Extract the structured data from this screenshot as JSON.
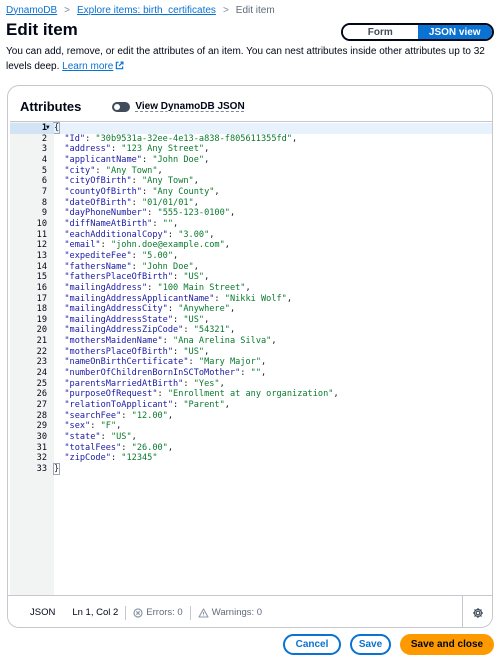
{
  "breadcrumb": {
    "items": [
      "DynamoDB",
      "Explore items: birth_certificates"
    ],
    "current": "Edit item",
    "separator": ">"
  },
  "header": {
    "title": "Edit item",
    "view_toggle": {
      "form_label": "Form",
      "json_label": "JSON view",
      "selected": "JSON view"
    }
  },
  "description": {
    "text": "You can add, remove, or edit the attributes of an item. You can nest attributes inside other attributes up to 32 levels deep.",
    "learn_more": "Learn more"
  },
  "attributes": {
    "title": "Attributes",
    "toggle_label": "View DynamoDB JSON",
    "toggle_on": false
  },
  "editor": {
    "active_line": 1,
    "lines": [
      {
        "n": "1",
        "type": "open",
        "text": "{"
      },
      {
        "n": "2",
        "key": "\"Id\"",
        "value": "\"30b9531a-32ee-4e13-a838-f805611355fd\"",
        "comma": ","
      },
      {
        "n": "3",
        "key": "\"address\"",
        "value": "\"123 Any Street\"",
        "comma": ","
      },
      {
        "n": "4",
        "key": "\"applicantName\"",
        "value": "\"John Doe\"",
        "comma": ","
      },
      {
        "n": "5",
        "key": "\"city\"",
        "value": "\"Any Town\"",
        "comma": ","
      },
      {
        "n": "6",
        "key": "\"cityOfBirth\"",
        "value": "\"Any Town\"",
        "comma": ","
      },
      {
        "n": "7",
        "key": "\"countyOfBirth\"",
        "value": "\"Any County\"",
        "comma": ","
      },
      {
        "n": "8",
        "key": "\"dateOfBirth\"",
        "value": "\"01/01/01\"",
        "comma": ","
      },
      {
        "n": "9",
        "key": "\"dayPhoneNumber\"",
        "value": "\"555-123-0100\"",
        "comma": ","
      },
      {
        "n": "10",
        "key": "\"diffNameAtBirth\"",
        "value": "\"\"",
        "comma": ","
      },
      {
        "n": "11",
        "key": "\"eachAdditionalCopy\"",
        "value": "\"3.00\"",
        "comma": ","
      },
      {
        "n": "12",
        "key": "\"email\"",
        "value": "\"john.doe@example.com\"",
        "comma": ","
      },
      {
        "n": "13",
        "key": "\"expediteFee\"",
        "value": "\"5.00\"",
        "comma": ","
      },
      {
        "n": "14",
        "key": "\"fathersName\"",
        "value": "\"John Doe\"",
        "comma": ","
      },
      {
        "n": "15",
        "key": "\"fathersPlaceOfBirth\"",
        "value": "\"US\"",
        "comma": ","
      },
      {
        "n": "16",
        "key": "\"mailingAddress\"",
        "value": "\"100 Main Street\"",
        "comma": ","
      },
      {
        "n": "17",
        "key": "\"mailingAddressApplicantName\"",
        "value": "\"Nikki Wolf\"",
        "comma": ","
      },
      {
        "n": "18",
        "key": "\"mailingAddressCity\"",
        "value": "\"Anywhere\"",
        "comma": ","
      },
      {
        "n": "19",
        "key": "\"mailingAddressState\"",
        "value": "\"US\"",
        "comma": ","
      },
      {
        "n": "20",
        "key": "\"mailingAddressZipCode\"",
        "value": "\"54321\"",
        "comma": ","
      },
      {
        "n": "21",
        "key": "\"mothersMaidenName\"",
        "value": "\"Ana Arelina Silva\"",
        "comma": ","
      },
      {
        "n": "22",
        "key": "\"mothersPlaceOfBirth\"",
        "value": "\"US\"",
        "comma": ","
      },
      {
        "n": "23",
        "key": "\"nameOnBirthCertificate\"",
        "value": "\"Mary Major\"",
        "comma": ","
      },
      {
        "n": "24",
        "key": "\"numberOfChildrenBornInSCToMother\"",
        "value": "\"\"",
        "comma": ","
      },
      {
        "n": "25",
        "key": "\"parentsMarriedAtBirth\"",
        "value": "\"Yes\"",
        "comma": ","
      },
      {
        "n": "26",
        "key": "\"purposeOfRequest\"",
        "value": "\"Enrollment at any organization\"",
        "comma": ","
      },
      {
        "n": "27",
        "key": "\"relationToApplicant\"",
        "value": "\"Parent\"",
        "comma": ","
      },
      {
        "n": "28",
        "key": "\"searchFee\"",
        "value": "\"12.00\"",
        "comma": ","
      },
      {
        "n": "29",
        "key": "\"sex\"",
        "value": "\"F\"",
        "comma": ","
      },
      {
        "n": "30",
        "key": "\"state\"",
        "value": "\"US\"",
        "comma": ","
      },
      {
        "n": "31",
        "key": "\"totalFees\"",
        "value": "\"26.00\"",
        "comma": ","
      },
      {
        "n": "32",
        "key": "\"zipCode\"",
        "value": "\"12345\"",
        "comma": ""
      },
      {
        "n": "33",
        "type": "close",
        "text": "}"
      }
    ]
  },
  "status_bar": {
    "language": "JSON",
    "position": "Ln 1, Col 2",
    "errors": "Errors: 0",
    "warnings": "Warnings: 0"
  },
  "footer": {
    "cancel": "Cancel",
    "save": "Save",
    "save_close": "Save and close"
  },
  "colors": {
    "link": "#0972d3",
    "primary": "#ff9900",
    "json_key": "#1a1aa6",
    "json_string": "#0a7a2e"
  },
  "icons": {
    "external_link": "external-link-icon",
    "fold": "caret-down-icon",
    "errors": "error-icon",
    "warnings": "warning-icon",
    "settings": "gear-icon"
  }
}
